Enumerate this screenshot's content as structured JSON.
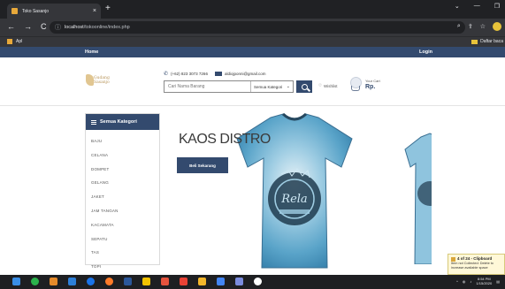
{
  "browser": {
    "tab_title": "Toko Sasanjo",
    "tab_close": "×",
    "new_tab": "+",
    "window_controls": [
      "⌄",
      "—",
      "❐"
    ],
    "nav_back": "←",
    "nav_forward": "→",
    "nav_reload": "C",
    "address_prefix": "localhost",
    "address_path": "/tokoonline/index.php",
    "bookmarks_apps": "Apl",
    "bookmarks_other": "Daftar baca"
  },
  "site_nav": {
    "home": "Home",
    "login": "Login"
  },
  "header": {
    "logo_text": "Gudang Sasanjo",
    "phone": "(+62) 823 3073 7266",
    "email": "aldiojponni@gmail.com",
    "search_placeholder": "Cari Nama Barang",
    "category_select": "Semua Kategori",
    "wishlist": "Wishlist",
    "cart_label": "Your Cart",
    "cart_amount": "Rp."
  },
  "sidebar": {
    "title": "Semua Kategori",
    "items": [
      "BAJU",
      "CELANA",
      "DOMPET",
      "GELANG",
      "JAKET",
      "JAM TANGAN",
      "KACAMATA",
      "SEPATU",
      "TAS",
      "TOPI"
    ]
  },
  "hero": {
    "title": "KAOS DISTRO",
    "button": "Beli Sekarang",
    "shirt_print": "Rela"
  },
  "taskbar": {
    "time": "8:54 PM",
    "date": "1/15/2020"
  },
  "toast": {
    "title": "4 of 24 - Clipboard",
    "body": "Item not Collected: Delete to increase available space"
  },
  "colors": {
    "brand": "#334a6e",
    "browser_dark": "#202124",
    "browser_mid": "#35363a"
  }
}
